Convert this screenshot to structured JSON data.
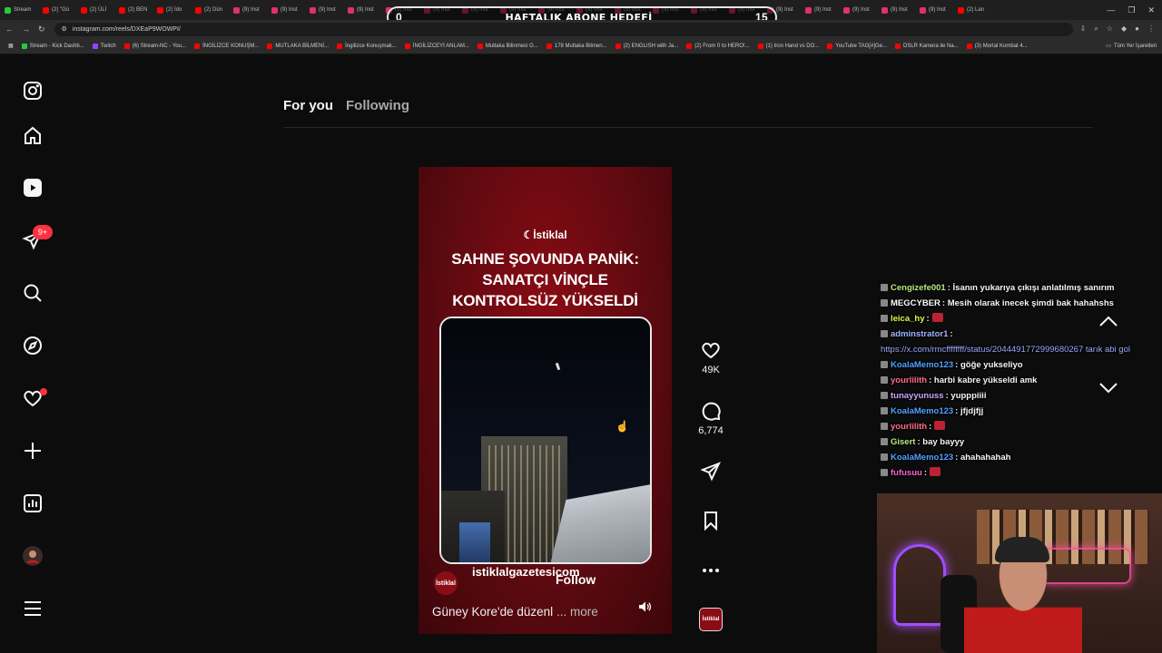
{
  "browser": {
    "tabs": [
      {
        "label": "Stream",
        "color": "#27c93f"
      },
      {
        "label": "(2) \"Gü",
        "color": "#ff0000"
      },
      {
        "label": "(2) ÜLİ",
        "color": "#ff0000"
      },
      {
        "label": "(2) BEN",
        "color": "#ff0000"
      },
      {
        "label": "(2) İdo",
        "color": "#ff0000"
      },
      {
        "label": "(2) Dün",
        "color": "#ff0000"
      },
      {
        "label": "(9) Inst",
        "color": "#e1306c"
      },
      {
        "label": "(9) Inst",
        "color": "#e1306c"
      },
      {
        "label": "(9) Inst",
        "color": "#e1306c"
      },
      {
        "label": "(9) Inst",
        "color": "#e1306c"
      },
      {
        "label": "(9) Inst",
        "color": "#e1306c"
      },
      {
        "label": "(9) Inst",
        "color": "#e1306c"
      },
      {
        "label": "(9) Inst",
        "color": "#e1306c"
      },
      {
        "label": "(9) Inst",
        "color": "#e1306c"
      },
      {
        "label": "(9) Inst",
        "color": "#e1306c"
      },
      {
        "label": "(9) Inst",
        "color": "#e1306c"
      },
      {
        "label": "(9) Inst",
        "color": "#e1306c"
      },
      {
        "label": "(9) Inst",
        "color": "#e1306c"
      },
      {
        "label": "(9) Inst",
        "color": "#e1306c"
      },
      {
        "label": "(9) Inst",
        "color": "#e1306c"
      },
      {
        "label": "(9) Inst",
        "color": "#e1306c"
      },
      {
        "label": "(9) Inst",
        "color": "#e1306c"
      },
      {
        "label": "(9) Inst",
        "color": "#e1306c"
      },
      {
        "label": "(9) Inst",
        "color": "#e1306c"
      },
      {
        "label": "(9) Inst",
        "color": "#e1306c"
      },
      {
        "label": "(2) Lan",
        "color": "#ff0000"
      }
    ],
    "overlay": {
      "left": "0",
      "title": "HAFTALIK ABONE HEDEFİ",
      "right": "15"
    },
    "url": "instagram.com/reels/DXEaP9WOWPI/",
    "bookmarks": [
      {
        "label": "Stream - Kick Dashb...",
        "color": "#27c93f"
      },
      {
        "label": "Twitch",
        "color": "#9146ff"
      },
      {
        "label": "(6) Stream-NC - You...",
        "color": "#ff0000"
      },
      {
        "label": "İNGİLİZCE KONUŞM...",
        "color": "#ff0000"
      },
      {
        "label": "MUTLAKA BİLMENİ...",
        "color": "#ff0000"
      },
      {
        "label": "İngilizce Konuşmak...",
        "color": "#ff0000"
      },
      {
        "label": "İNGİLİZCEYİ ANLAM...",
        "color": "#ff0000"
      },
      {
        "label": "Mutlaka Bilinmesi G...",
        "color": "#ff0000"
      },
      {
        "label": "178 Mutlaka Bilmen...",
        "color": "#ff0000"
      },
      {
        "label": "(2) ENGLISH with Ja...",
        "color": "#ff0000"
      },
      {
        "label": "(2) From 0 to HERO!...",
        "color": "#ff0000"
      },
      {
        "label": "(1) Iron Hand vs DO...",
        "color": "#ff0000"
      },
      {
        "label": "YouTube TAG[#]Ge...",
        "color": "#ff0000"
      },
      {
        "label": "DSLR Kamera ile Na...",
        "color": "#ff0000"
      },
      {
        "label": "(3) Mortal Kombat 4...",
        "color": "#ff0000"
      }
    ],
    "all_bookmarks": "Tüm Yer İşaretleri"
  },
  "sidebar": {
    "icons": [
      "instagram-logo-icon",
      "home-icon",
      "reels-icon",
      "messages-icon",
      "search-icon",
      "explore-icon",
      "notifications-icon",
      "create-icon",
      "dashboard-icon",
      "profile-avatar",
      "more-menu-icon"
    ],
    "messages_badge": "9+"
  },
  "feed": {
    "tab_for_you": "For you",
    "tab_following": "Following"
  },
  "reel": {
    "logo": "☾İstiklal",
    "headline": "SAHNE ŞOVUNDA PANİK: SANATÇI VİNÇLE KONTROLSÜZ YÜKSELDİ",
    "author": "istiklalgazetesicom",
    "author_avatar_text": "İstiklal",
    "follow": "Follow",
    "caption": "Güney Kore'de düzenl",
    "more": "... more",
    "likes": "49K",
    "comments": "6,774",
    "audio_thumb_text": "İstiklal"
  },
  "chat": [
    {
      "user": "Cengizefe001",
      "user_color": "#b8e986",
      "text": ": İsanın yukarıya çıkışı anlatılmış sanırım"
    },
    {
      "user": "MEGCYBER",
      "user_color": "#ffffff",
      "text": ": Mesih olarak inecek şimdi bak hahahshs"
    },
    {
      "user": "leica_hy",
      "user_color": "#d7ff4a",
      "text": ":"
    },
    {
      "user": "adminstrator1",
      "user_color": "#a0b4ff",
      "text": ":"
    },
    {
      "user": "",
      "user_color": "#9fa8ff",
      "text": "https://x.com/rmcffffffff/status/2044491772999680267 tarık abi gol"
    },
    {
      "user": "KoalaMemo123",
      "user_color": "#4fa3ff",
      "text": ": göğe yukseliyo"
    },
    {
      "user": "yourlilith",
      "user_color": "#ff6b8a",
      "text": ": harbi kabre yükseldi amk"
    },
    {
      "user": "tunayyunuss",
      "user_color": "#c9a6ff",
      "text": ": yupppiiii"
    },
    {
      "user": "KoalaMemo123",
      "user_color": "#4fa3ff",
      "text": ": jfjdjfjj"
    },
    {
      "user": "yourlilith",
      "user_color": "#ff6b8a",
      "text": ":"
    },
    {
      "user": "Gisert",
      "user_color": "#b8e986",
      "text": ": bay bayyy"
    },
    {
      "user": "KoalaMemo123",
      "user_color": "#4fa3ff",
      "text": ": ahahahahah"
    },
    {
      "user": "fufusuu",
      "user_color": "#ff5fd2",
      "text": ":"
    }
  ]
}
